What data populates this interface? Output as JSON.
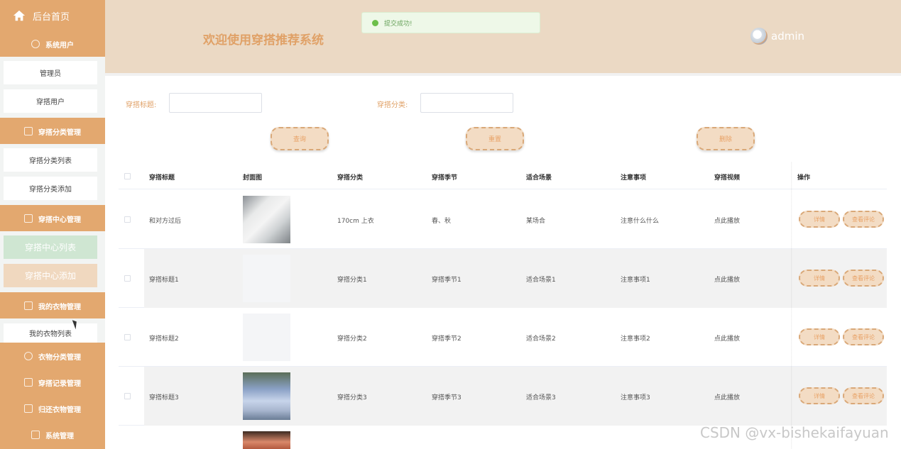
{
  "sidebar": {
    "home_label": "后台首页",
    "groups": {
      "system_users": "系统用户",
      "category_mgmt": "穿搭分类管理",
      "center_mgmt": "穿搭中心管理",
      "my_clothes_mgmt": "我的衣物管理",
      "clothes_category_mgmt": "衣物分类管理",
      "record_mgmt": "穿搭记录管理",
      "return_mgmt": "归还衣物管理",
      "system_mgmt": "系统管理"
    },
    "items": {
      "admin": "管理员",
      "users": "穿搭用户",
      "category_list": "穿搭分类列表",
      "category_add": "穿搭分类添加",
      "center_list": "穿搭中心列表",
      "center_add": "穿搭中心添加",
      "my_clothes_list": "我的衣物列表"
    }
  },
  "header": {
    "title": "欢迎使用穿搭推荐系统",
    "toast": "提交成功!",
    "username": "admin"
  },
  "search": {
    "title_label": "穿搭标题:",
    "category_label": "穿搭分类:",
    "query_button": "查询",
    "reset_button": "重置",
    "delete_button": "删除"
  },
  "table": {
    "columns": [
      "穿搭标题",
      "封面图",
      "穿搭分类",
      "穿搭季节",
      "适合场景",
      "注意事项",
      "穿搭视频",
      "操作"
    ],
    "rows": [
      {
        "title": "和对方过后",
        "category": "170cm 上衣",
        "season": "春、秋",
        "scene": "某场合",
        "notes": "注意什么什么",
        "video": "点此播放"
      },
      {
        "title": "穿搭标题1",
        "category": "穿搭分类1",
        "season": "穿搭季节1",
        "scene": "适合场景1",
        "notes": "注意事项1",
        "video": "点此播放"
      },
      {
        "title": "穿搭标题2",
        "category": "穿搭分类2",
        "season": "穿搭季节2",
        "scene": "适合场景2",
        "notes": "注意事项2",
        "video": "点此播放"
      },
      {
        "title": "穿搭标题3",
        "category": "穿搭分类3",
        "season": "穿搭季节3",
        "scene": "适合场景3",
        "notes": "注意事项3",
        "video": "点此播放"
      }
    ],
    "actions": {
      "detail": "详情",
      "comments": "查看评论"
    }
  },
  "watermark": "CSDN @vx-bishekaifayuan",
  "colors": {
    "sidebar": "#e3a86f",
    "header": "#ebd9c4",
    "accent": "#e0a167",
    "toast": "#67a25a"
  }
}
